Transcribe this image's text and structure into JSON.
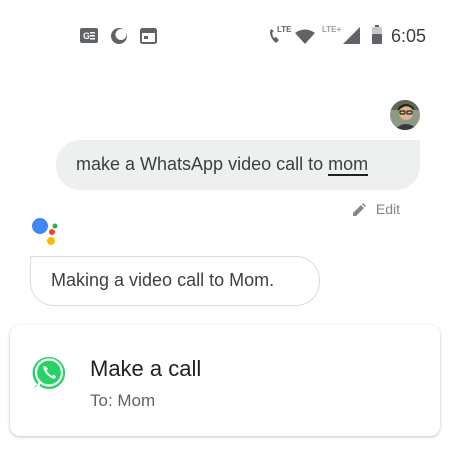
{
  "status_bar": {
    "time": "6:05",
    "lte_label": "LTE",
    "lte_plus_label": "LTE+",
    "icons": [
      "news-icon",
      "moon-icon",
      "calendar-icon",
      "wifi-calling-icon",
      "wifi-icon",
      "signal-icon",
      "battery-icon"
    ]
  },
  "conversation": {
    "user_query_prefix": "make a WhatsApp video call to ",
    "user_query_contact": "mom",
    "edit_label": "Edit",
    "assistant_reply": "Making a video call to Mom."
  },
  "call_card": {
    "title": "Make a call",
    "subtitle": "To: Mom",
    "app_icon": "whatsapp-icon"
  },
  "colors": {
    "bubble_bg": "#eef0f0",
    "whatsapp_green": "#25d366",
    "assistant_blue": "#4285f4",
    "assistant_red": "#ea4335",
    "assistant_yellow": "#fbbc05",
    "assistant_green": "#34a853"
  }
}
